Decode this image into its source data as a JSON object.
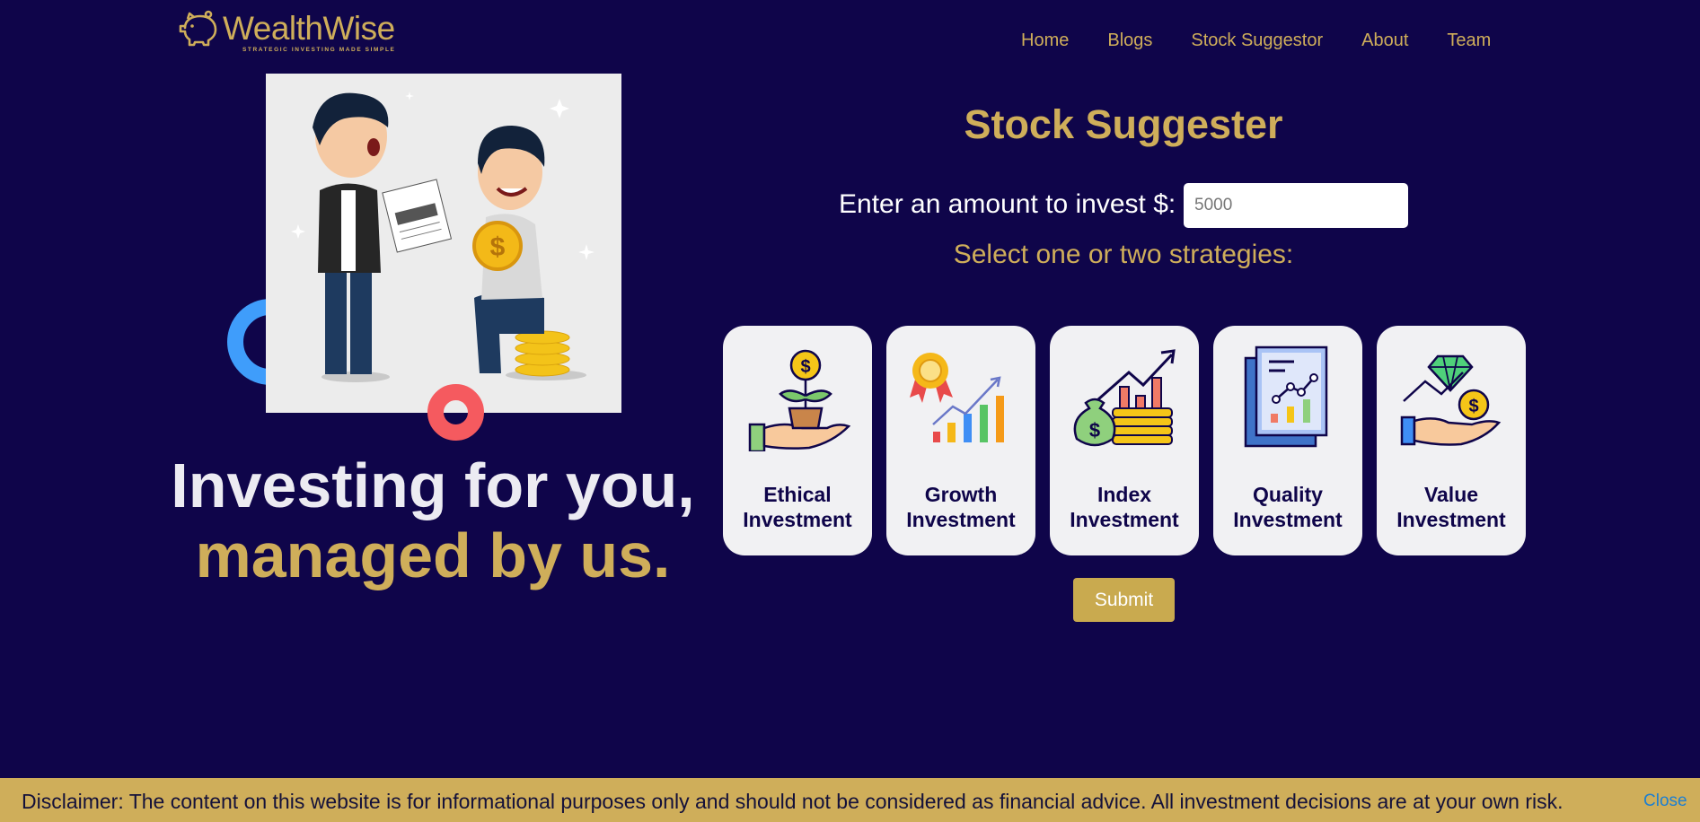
{
  "brand": {
    "name": "WealthWise",
    "tagline": "STRATEGIC INVESTING MADE SIMPLE",
    "color": "#cfae5a"
  },
  "nav": {
    "items": [
      "Home",
      "Blogs",
      "Stock Suggestor",
      "About",
      "Team"
    ]
  },
  "hero": {
    "line1": "Investing for you,",
    "line2": "managed by us."
  },
  "form": {
    "title": "Stock Suggester",
    "amount_label": "Enter an amount to invest $:",
    "amount_placeholder": "5000",
    "strategies_label": "Select one or two strategies:",
    "strategies": [
      {
        "line1": "Ethical",
        "line2": "Investment",
        "icon": "plant-money-hand-icon"
      },
      {
        "line1": "Growth",
        "line2": "Investment",
        "icon": "growth-chart-icon"
      },
      {
        "line1": "Index",
        "line2": "Investment",
        "icon": "money-bag-coins-chart-icon"
      },
      {
        "line1": "Quality",
        "line2": "Investment",
        "icon": "report-chart-icon"
      },
      {
        "line1": "Value",
        "line2": "Investment",
        "icon": "diamond-hand-icon"
      }
    ],
    "submit_label": "Submit"
  },
  "disclaimer": {
    "text": "Disclaimer: The content on this website is for informational purposes only and should not be considered as financial advice. All investment decisions are at your own risk.",
    "close_label": "Close"
  },
  "colors": {
    "background": "#0f054a",
    "accent": "#cfae5a",
    "card": "#f1f1f3"
  }
}
